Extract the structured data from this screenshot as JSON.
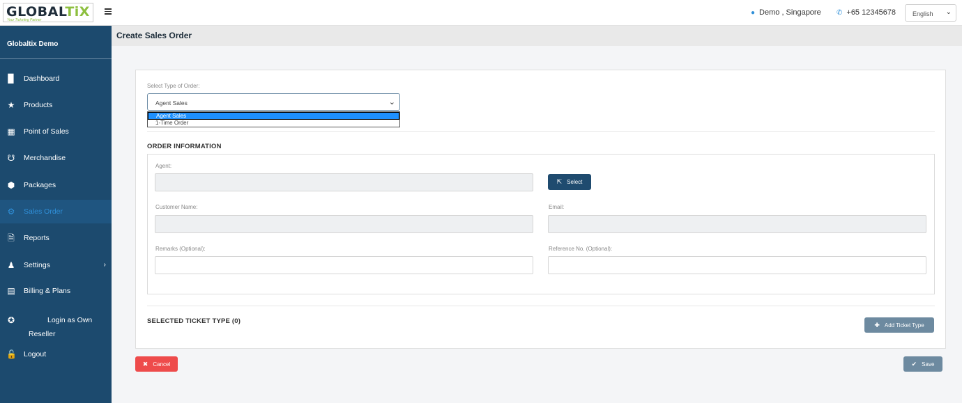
{
  "topbar": {
    "logo_main": "GLOBAL",
    "logo_accent": "TiX",
    "logo_tagline": "Your Ticketing Partner",
    "user": "Demo , Singapore",
    "phone": "+65 12345678",
    "language": "English"
  },
  "sidebar": {
    "brand": "Globaltix Demo",
    "items": [
      {
        "label": "Dashboard",
        "icon": "bar-chart-icon"
      },
      {
        "label": "Products",
        "icon": "ticket-icon"
      },
      {
        "label": "Point of Sales",
        "icon": "grid-icon"
      },
      {
        "label": "Merchandise",
        "icon": "cart-icon"
      },
      {
        "label": "Packages",
        "icon": "box-icon"
      },
      {
        "label": "Sales Order",
        "icon": "gear-icon",
        "active": true
      },
      {
        "label": "Reports",
        "icon": "file-icon"
      },
      {
        "label": "Settings",
        "icon": "user-settings-icon"
      },
      {
        "label": "Billing & Plans",
        "icon": "credit-card-icon"
      },
      {
        "label": "Login as Own Reseller",
        "icon": "star-circle-icon"
      },
      {
        "label": "Logout",
        "icon": "lock-icon"
      }
    ]
  },
  "page": {
    "title": "Create Sales Order"
  },
  "form": {
    "order_type_label": "Select Type of Order:",
    "order_type_value": "Agent Sales",
    "order_type_options": [
      "Agent Sales",
      "1-Time Order"
    ],
    "order_info_title": "ORDER INFORMATION",
    "agent_label": "Agent:",
    "agent_value": "",
    "select_button": "Select",
    "customer_name_label": "Customer Name:",
    "email_label": "Email:",
    "remarks_label": "Remarks (Optional):",
    "reference_label": "Reference No. (Optional):",
    "selected_ticket_title": "SELECTED TICKET TYPE (0)",
    "add_ticket_button": "Add Ticket Type"
  },
  "actions": {
    "cancel": "Cancel",
    "save": "Save"
  },
  "colors": {
    "sidebar": "#1c4a6e",
    "accent": "#2f8fd8",
    "cancel": "#ee4b4b",
    "secondary_button": "#6d8aa0"
  }
}
